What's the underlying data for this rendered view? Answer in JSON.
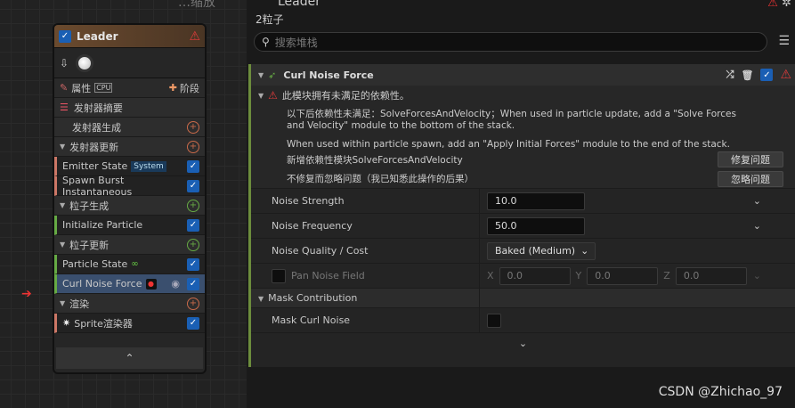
{
  "graph": {
    "top_label": "…缩放",
    "node": {
      "title": "Leader",
      "rows": [
        {
          "kind": "tabs",
          "left": "属性",
          "right": "阶段"
        },
        {
          "kind": "section",
          "label": "发射器摘要"
        },
        {
          "kind": "section",
          "label": "发射器生成"
        },
        {
          "kind": "section",
          "label": "发射器更新"
        },
        {
          "kind": "item",
          "label": "Emitter State",
          "tag": "System"
        },
        {
          "kind": "item",
          "label": "Spawn Burst Instantaneous"
        },
        {
          "kind": "section",
          "label": "粒子生成"
        },
        {
          "kind": "item",
          "label": "Initialize Particle"
        },
        {
          "kind": "section",
          "label": "粒子更新"
        },
        {
          "kind": "item",
          "label": "Particle State"
        },
        {
          "kind": "item",
          "label": "Curl Noise Force"
        },
        {
          "kind": "section",
          "label": "渲染"
        },
        {
          "kind": "item",
          "label": "Sprite渲染器"
        }
      ]
    }
  },
  "panel": {
    "title": "Leader",
    "subtitle": "2粒子",
    "search_placeholder": "搜索堆栈",
    "module_title": "Curl Noise Force",
    "warning_title": "此模块拥有未满足的依赖性。",
    "warning_text1": "以下后依赖性未满足：SolveForcesAndVelocity；When used in particle update, add a \"Solve Forces and Velocity\" module to the bottom of the stack.",
    "warning_text2": "When used within particle spawn, add an \"Apply Initial Forces\" module to the end of the stack.",
    "fix_label": "新增依赖性模块SolveForcesAndVelocity",
    "fix_button": "修复问题",
    "ignore_label": "不修复而忽略问题（我已知悉此操作的后果）",
    "ignore_button": "忽略问题",
    "noise_strength_label": "Noise Strength",
    "noise_strength_value": "10.0",
    "noise_frequency_label": "Noise Frequency",
    "noise_frequency_value": "50.0",
    "noise_quality_label": "Noise Quality / Cost",
    "noise_quality_value": "Baked (Medium)",
    "pan_noise_label": "Pan Noise Field",
    "pan_x": "0.0",
    "pan_y": "0.0",
    "pan_z": "0.0",
    "mask_section": "Mask Contribution",
    "mask_curl_label": "Mask Curl Noise"
  },
  "watermark": "CSDN @Zhichao_97"
}
